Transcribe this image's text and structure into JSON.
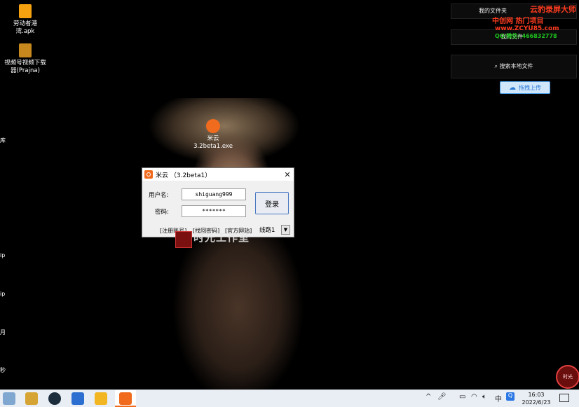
{
  "desktop": {
    "icons": [
      {
        "label": "劳动者港湾.apk",
        "color": "#f6a10f"
      },
      {
        "label": "视频号视频下载器(Prajna)",
        "color": "#c7891d"
      },
      {
        "label": "米云3.2beta1.exe",
        "color": "#f06b1e"
      }
    ],
    "left_edge_texts": [
      "库",
      "ip",
      "ip",
      "月",
      "秒"
    ]
  },
  "cloud_panel": {
    "my_files": "我的文件夹",
    "my_files_2": "我的文件",
    "search_label": "搜索本地文件",
    "upload_label": "拖拽上传"
  },
  "watermark": {
    "brand": "云豹录屏大师",
    "line1": "中创网 热门项目",
    "line2": "www.ZCYU85.com",
    "line3": "QQ/微信: 466832778"
  },
  "dialog": {
    "title": "米云 （3.2beta1）",
    "username_label": "用户名:",
    "username_value": "shiguang999",
    "password_label": "密码:",
    "password_value": "*******",
    "login_label": "登录",
    "link_register": "[注册账号]",
    "link_retrieve": "[找回密码]",
    "link_website": "[官方网站]",
    "line_select": "线路1"
  },
  "overlay": {
    "studio_text": "时光工作室"
  },
  "badge": {
    "text": "时光"
  },
  "taskbar": {
    "apps": [
      {
        "name": "file-explorer-app-icon",
        "color": "#7fa7cf"
      },
      {
        "name": "settings-app-icon",
        "color": "#d6a434"
      },
      {
        "name": "nox-app-icon",
        "color": "#1b2c3c"
      },
      {
        "name": "media-player-app-icon",
        "color": "#2c6fd1"
      },
      {
        "name": "folder-app-icon",
        "color": "#f2b623"
      },
      {
        "name": "miyun-app-icon",
        "color": "#f06b1e"
      }
    ],
    "time": "16:03",
    "date": "2022/6/23"
  }
}
